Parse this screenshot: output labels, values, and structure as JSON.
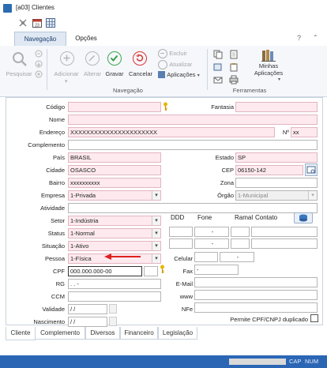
{
  "window": {
    "title": "[a03]  Clientes"
  },
  "ribbon_tabs": [
    {
      "label": "Navegação"
    },
    {
      "label": "Opções"
    }
  ],
  "help_glyph": "?",
  "ribbon": {
    "pesquisar": "Pesquisar",
    "adicionar": "Adicionar",
    "alterar": "Alterar",
    "gravar": "Gravar",
    "cancelar": "Cancelar",
    "excluir": "Excluir",
    "atualizar": "Atualizar",
    "aplicacoes": "Aplicações",
    "group_navegacao": "Navegação",
    "minhas": "Minhas",
    "minhas_aplicacoes": "Aplicações",
    "group_ferramentas": "Ferramentas"
  },
  "form": {
    "codigo": {
      "label": "Código",
      "value": ""
    },
    "fantasia": {
      "label": "Fantasia",
      "value": ""
    },
    "nome": {
      "label": "Nome",
      "value": ""
    },
    "endereco": {
      "label": "Endereço",
      "value": "XXXXXXXXXXXXXXXXXXXXXX"
    },
    "numero": {
      "label": "Nº",
      "value": "xx"
    },
    "complemento": {
      "label": "Complemento",
      "value": ""
    },
    "pais": {
      "label": "País",
      "value": "BRASIL"
    },
    "estado": {
      "label": "Estado",
      "value": "SP"
    },
    "cidade": {
      "label": "Cidade",
      "value": "OSASCO"
    },
    "cep": {
      "label": "CEP",
      "value": "06150-142"
    },
    "bairro": {
      "label": "Bairro",
      "value": "xxxxxxxxxx"
    },
    "zona": {
      "label": "Zona",
      "value": ""
    },
    "empresa": {
      "label": "Empresa",
      "value": "1-Privada"
    },
    "orgao": {
      "label": "Órgão",
      "value": "1-Municipal"
    },
    "atividade": {
      "label": "Atividade",
      "value": ""
    },
    "setor": {
      "label": "Setor",
      "value": "1-Indústria"
    },
    "status": {
      "label": "Status",
      "value": "1-Normal"
    },
    "situacao": {
      "label": "Situação",
      "value": "1-Ativo"
    },
    "pessoa": {
      "label": "Pessoa",
      "value": "1-Física"
    },
    "cpf": {
      "label": "CPF",
      "value": "000.000.000-00"
    },
    "rg": {
      "label": "RG",
      "value": ".   .   -"
    },
    "ccm": {
      "label": "CCM",
      "value": ""
    },
    "validade": {
      "label": "Validade",
      "value": "/  /"
    },
    "nascimento": {
      "label": "Nascimento",
      "value": "/  /"
    },
    "phones_header": {
      "ddd": "DDD",
      "fone": "Fone",
      "ramal": "Ramal",
      "contato": "Contato"
    },
    "phone_rows": [
      {
        "fone": "-"
      },
      {
        "fone": "-"
      },
      {
        "fone": "-"
      }
    ],
    "celular": {
      "label": "Celular",
      "value": "-"
    },
    "fax": {
      "label": "Fax",
      "value": "-"
    },
    "email": {
      "label": "E-Mail",
      "value": ""
    },
    "www": {
      "label": "www",
      "value": ""
    },
    "nfe": {
      "label": "NFe",
      "value": ""
    },
    "permite": {
      "label": "Permite CPF/CNPJ duplicado"
    }
  },
  "bottom_tabs": [
    {
      "label": "Cliente"
    },
    {
      "label": "Complemento"
    },
    {
      "label": "Diversos"
    },
    {
      "label": "Financeiro"
    },
    {
      "label": "Legislação"
    }
  ],
  "statusbar": {
    "cap": "CAP",
    "num": "NUM"
  },
  "colors": {
    "accent": "#2b66b5",
    "required_field": "#fde9ee",
    "arrow": "#e02020"
  }
}
